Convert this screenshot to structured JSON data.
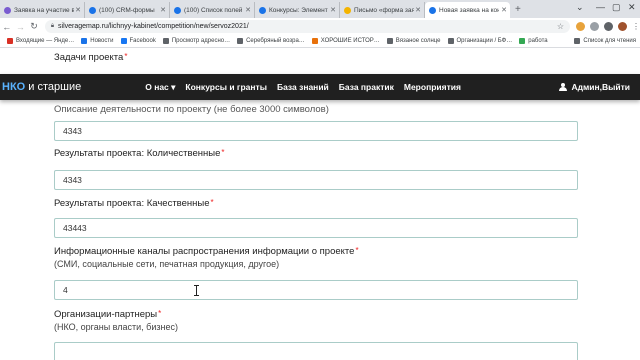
{
  "browser": {
    "tabs": [
      {
        "label": "Заявка на участие в …",
        "color": "#7a5cd0"
      },
      {
        "label": "(100) CRM-формы",
        "color": "#1a73e8"
      },
      {
        "label": "(100) Список полей …",
        "color": "#1a73e8"
      },
      {
        "label": "Конкурсы: Элемент …",
        "color": "#1a73e8"
      },
      {
        "label": "Письмо «форма заяв…",
        "color": "#f4b400"
      },
      {
        "label": "Новая заявка на кон…",
        "color": "#1a73e8"
      }
    ],
    "url": "silveragemap.ru/lichnyy-kabinet/competition/new/servoz2021/",
    "bookmarks": [
      {
        "label": "Входящие — Янде…",
        "color": "#d93025"
      },
      {
        "label": "Новости",
        "color": "#1a73e8"
      },
      {
        "label": "Facebook",
        "color": "#1877f2"
      },
      {
        "label": "Просмотр адресно…",
        "color": "#5f6368"
      },
      {
        "label": "Серебряный возра…",
        "color": "#5f6368"
      },
      {
        "label": "ХОРОШИЕ ИСТОР…",
        "color": "#e8710a"
      },
      {
        "label": "Вязаное солнце",
        "color": "#5f6368"
      },
      {
        "label": "Организации / БФ…",
        "color": "#5f6368"
      },
      {
        "label": "работа",
        "color": "#34a853"
      },
      {
        "label": "Список для чтения",
        "color": "#5f6368"
      }
    ]
  },
  "site": {
    "logo_main": "НКО",
    "logo_rest": "и старшие",
    "menu": [
      "О нас ▾",
      "Конкурсы и гранты",
      "База знаний",
      "База практик",
      "Мероприятия"
    ],
    "user_label": "Админ,Выйти"
  },
  "form": {
    "tasks_label": "Задачи проекта",
    "description_label": "Описание деятельности по проекту (не более 3000 символов)",
    "description_value": "4343",
    "quant_label": "Результаты проекта: Количественные",
    "quant_value": "4343",
    "qual_label": "Результаты проекта: Качественные",
    "qual_value": "43443",
    "channels_label": "Информационные каналы распространения информации о проекте",
    "channels_hint": "(СМИ, социальные сети, печатная продукция, другое)",
    "channels_value": "4",
    "partners_label": "Организации-партнеры",
    "partners_hint": "(НКО, органы власти, бизнес)",
    "partners_value": "",
    "required_mark": "*"
  }
}
